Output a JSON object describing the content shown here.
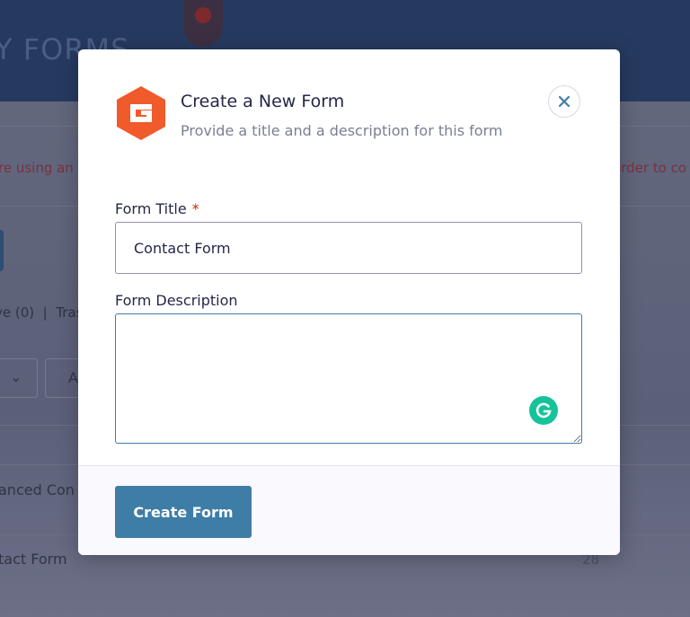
{
  "background": {
    "header_text": "Y FORMS",
    "notice_left": "re using an",
    "notice_right": "order to co",
    "filter_text": "ve (0)  |  Tras",
    "apply_fragment": "A",
    "row1": "anced Con",
    "row2": "tact Form",
    "row2_count": "28"
  },
  "modal": {
    "title": "Create a New Form",
    "subtitle": "Provide a title and a description for this form",
    "form_title_label": "Form Title",
    "required_marker": "*",
    "form_title_value": "Contact Form",
    "form_description_label": "Form Description",
    "form_description_value": "",
    "create_button": "Create Form",
    "icons": {
      "logo": "gravity-forms-logo-icon",
      "close": "close-icon",
      "grammarly": "grammarly-icon"
    }
  },
  "colors": {
    "accent": "#3e7da6",
    "logo_orange": "#f15a2b",
    "grammarly_green": "#15c39a",
    "required_red": "#c02b0a"
  }
}
